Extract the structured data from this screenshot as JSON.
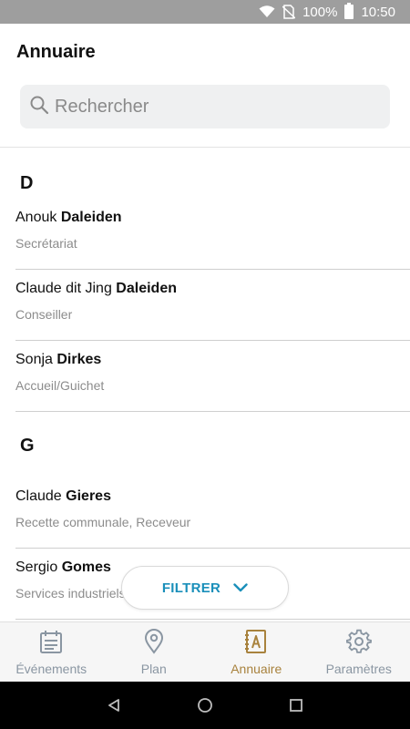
{
  "status_bar": {
    "battery": "100%",
    "time": "10:50"
  },
  "header": {
    "title": "Annuaire"
  },
  "search": {
    "placeholder": "Rechercher"
  },
  "sections": [
    {
      "letter": "D",
      "contacts": [
        {
          "first": "Anouk",
          "last": "Daleiden",
          "role": "Secrétariat"
        },
        {
          "first": "Claude dit Jing",
          "last": "Daleiden",
          "role": "Conseiller"
        },
        {
          "first": "Sonja",
          "last": "Dirkes",
          "role": "Accueil/Guichet"
        }
      ]
    },
    {
      "letter": "G",
      "contacts": [
        {
          "first": "Claude",
          "last": "Gieres",
          "role": "Recette communale, Receveur"
        },
        {
          "first": "Sergio",
          "last": "Gomes",
          "role": "Services industriels"
        }
      ]
    }
  ],
  "filter": {
    "label": "FILTRER"
  },
  "nav": {
    "items": [
      {
        "label": "Événements",
        "icon": "calendar-icon"
      },
      {
        "label": "Plan",
        "icon": "map-pin-icon"
      },
      {
        "label": "Annuaire",
        "icon": "address-book-icon"
      },
      {
        "label": "Paramètres",
        "icon": "gear-icon"
      }
    ],
    "active_index": 2
  },
  "colors": {
    "accent_blue": "#1a8fba",
    "active_gold": "#a8823d",
    "nav_inactive": "#8a96a2"
  }
}
